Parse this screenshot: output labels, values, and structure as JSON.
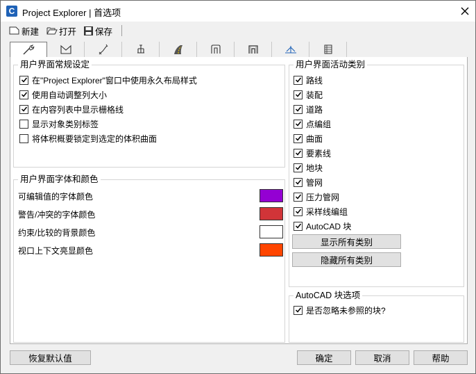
{
  "window": {
    "title": "Project Explorer | 首选项",
    "app_icon_letter": "C"
  },
  "toolbar": {
    "new_label": "新建",
    "open_label": "打开",
    "save_label": "保存"
  },
  "tabs": [
    {
      "icon": "wrench-icon",
      "active": true
    },
    {
      "icon": "envelope-icon"
    },
    {
      "icon": "curve-icon"
    },
    {
      "icon": "structure-icon"
    },
    {
      "icon": "road-icon"
    },
    {
      "icon": "corridor-icon"
    },
    {
      "icon": "pipe-network-icon"
    },
    {
      "icon": "profile-icon"
    },
    {
      "icon": "table-icon"
    }
  ],
  "general": {
    "title": "用户界面常规设定",
    "items": [
      {
        "label": "在\"Project Explorer\"窗口中使用永久布局样式",
        "checked": true
      },
      {
        "label": "使用自动调整列大小",
        "checked": true
      },
      {
        "label": "在内容列表中显示栅格线",
        "checked": true
      },
      {
        "label": "显示对象类别标签",
        "checked": false
      },
      {
        "label": "将体积概要锁定到选定的体积曲面",
        "checked": false
      }
    ]
  },
  "fonts": {
    "title": "用户界面字体和颜色",
    "items": [
      {
        "label": "可编辑值的字体颜色",
        "color": "#9400d3"
      },
      {
        "label": "警告/冲突的字体颜色",
        "color": "#d13438"
      },
      {
        "label": "约束/比较的背景颜色",
        "color": "#ffffff"
      },
      {
        "label": "视口上下文亮显颜色",
        "color": "#ff4500"
      }
    ]
  },
  "categories": {
    "title": "用户界面活动类别",
    "items": [
      {
        "label": "路线",
        "checked": true
      },
      {
        "label": "装配",
        "checked": true
      },
      {
        "label": "道路",
        "checked": true
      },
      {
        "label": "点编组",
        "checked": true
      },
      {
        "label": "曲面",
        "checked": true
      },
      {
        "label": "要素线",
        "checked": true
      },
      {
        "label": "地块",
        "checked": true
      },
      {
        "label": "管网",
        "checked": true
      },
      {
        "label": "压力管网",
        "checked": true
      },
      {
        "label": "采样线编组",
        "checked": true
      },
      {
        "label": "AutoCAD 块",
        "checked": true
      }
    ],
    "show_all_label": "显示所有类别",
    "hide_all_label": "隐藏所有类别"
  },
  "block_options": {
    "title": "AutoCAD 块选项",
    "ignore_label": "是否忽略未参照的块?",
    "ignore_checked": true
  },
  "footer": {
    "restore_label": "恢复默认值",
    "ok_label": "确定",
    "cancel_label": "取消",
    "help_label": "帮助"
  }
}
